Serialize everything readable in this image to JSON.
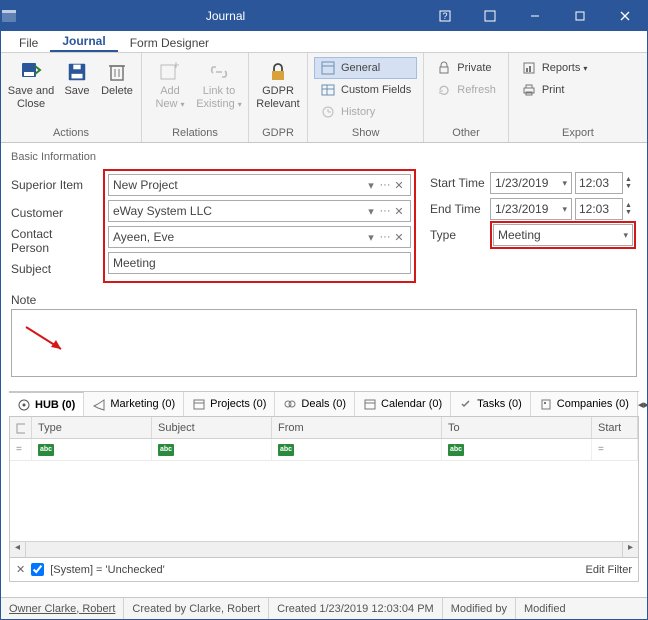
{
  "window": {
    "title": "Journal"
  },
  "menu": {
    "file": "File",
    "journal": "Journal",
    "form_designer": "Form Designer"
  },
  "ribbon": {
    "actions": {
      "label": "Actions",
      "save_close": "Save and Close",
      "save": "Save",
      "delete": "Delete"
    },
    "relations": {
      "label": "Relations",
      "add_new": "Add New",
      "link_existing": "Link to Existing"
    },
    "gdpr": {
      "label": "GDPR",
      "relevant": "GDPR Relevant"
    },
    "show": {
      "label": "Show",
      "general": "General",
      "custom_fields": "Custom Fields",
      "history": "History"
    },
    "other": {
      "label": "Other",
      "private": "Private",
      "refresh": "Refresh"
    },
    "export": {
      "label": "Export",
      "reports": "Reports",
      "print": "Print"
    }
  },
  "form": {
    "section": "Basic Information",
    "superior_item": {
      "label": "Superior Item",
      "value": "New Project"
    },
    "customer": {
      "label": "Customer",
      "value": "eWay System LLC"
    },
    "contact": {
      "label": "Contact Person",
      "value": "Ayeen, Eve"
    },
    "subject": {
      "label": "Subject",
      "value": "Meeting"
    },
    "start_time": {
      "label": "Start Time",
      "date": "1/23/2019",
      "time": "12:03"
    },
    "end_time": {
      "label": "End Time",
      "date": "1/23/2019",
      "time": "12:03"
    },
    "type": {
      "label": "Type",
      "value": "Meeting"
    },
    "note": {
      "label": "Note"
    }
  },
  "tabs": {
    "hub": "HUB (0)",
    "marketing": "Marketing (0)",
    "projects": "Projects (0)",
    "deals": "Deals (0)",
    "calendar": "Calendar (0)",
    "tasks": "Tasks (0)",
    "companies": "Companies (0)"
  },
  "grid": {
    "cols": {
      "type": "Type",
      "subject": "Subject",
      "from": "From",
      "to": "To",
      "start": "Start"
    }
  },
  "filterbar": {
    "expr": "[System] = 'Unchecked'",
    "edit": "Edit Filter"
  },
  "status": {
    "owner": "Owner Clarke, Robert",
    "created_by": "Created by Clarke, Robert",
    "created": "Created 1/23/2019 12:03:04 PM",
    "modified_by": "Modified by",
    "modified": "Modified"
  }
}
